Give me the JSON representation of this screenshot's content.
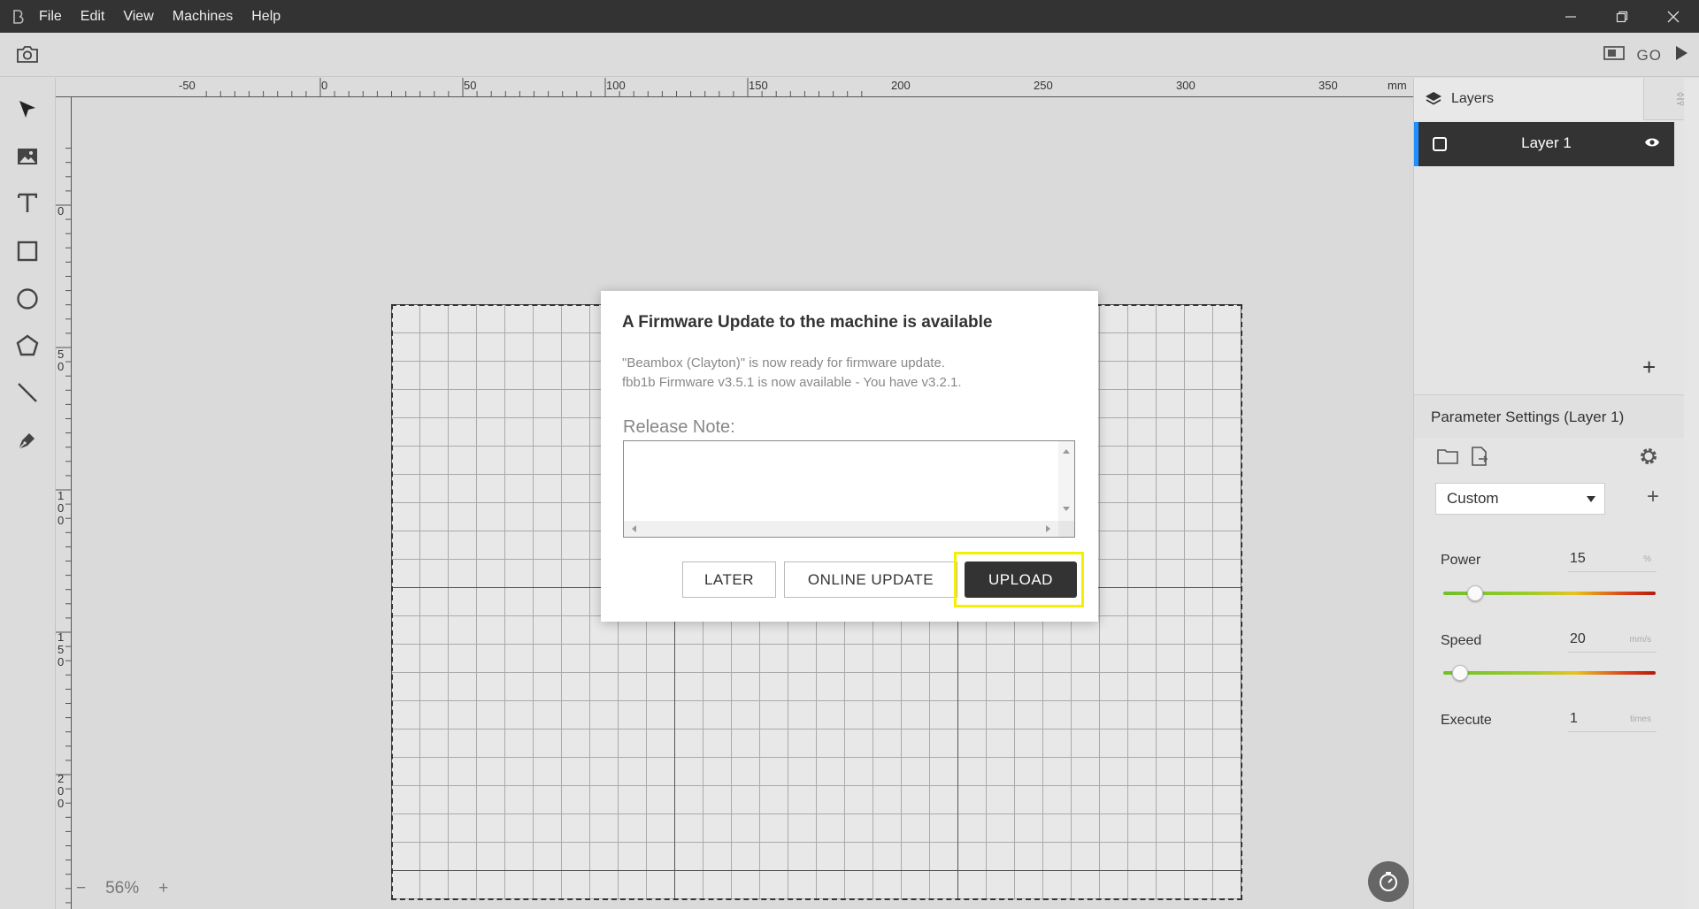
{
  "titlebar": {
    "menu": [
      "File",
      "Edit",
      "View",
      "Machines",
      "Help"
    ]
  },
  "toolbar": {
    "go_label": "GO"
  },
  "ruler": {
    "unit": "mm",
    "top_labels": [
      "-50",
      "0",
      "50",
      "100",
      "150",
      "200",
      "250",
      "300",
      "350"
    ],
    "left_labels": [
      "0",
      "50",
      "100",
      "150",
      "200"
    ]
  },
  "tools": [
    "select-tool",
    "image-tool",
    "text-tool",
    "rectangle-tool",
    "ellipse-tool",
    "polygon-tool",
    "line-tool",
    "pen-tool"
  ],
  "zoom": {
    "minus": "−",
    "value": "56%",
    "plus": "+"
  },
  "modal": {
    "title": "A Firmware Update to the machine is available",
    "message_line1": "\"Beambox (Clayton)\" is now ready for firmware update.",
    "message_line2": "fbb1b Firmware v3.5.1 is now available - You have v3.2.1.",
    "release_note_label": "Release Note:",
    "release_note_content": "",
    "buttons": {
      "later": "LATER",
      "online_update": "ONLINE UPDATE",
      "upload": "UPLOAD"
    }
  },
  "layers": {
    "tab_label": "Layers",
    "items": [
      {
        "name": "Layer 1",
        "visible": true
      }
    ],
    "add_symbol": "+"
  },
  "params": {
    "header": "Parameter Settings (Layer 1)",
    "preset": "Custom",
    "preset_add": "+",
    "power": {
      "label": "Power",
      "value": "15",
      "unit": "%",
      "fraction": 0.15
    },
    "speed": {
      "label": "Speed",
      "value": "20",
      "unit": "mm/s",
      "fraction": 0.08
    },
    "execute": {
      "label": "Execute",
      "value": "1",
      "unit": "times"
    }
  },
  "colors": {
    "titlebar": "#333333",
    "accent_layer": "#1e90ff",
    "highlight": "#f5f000",
    "upload_button": "#333333"
  }
}
